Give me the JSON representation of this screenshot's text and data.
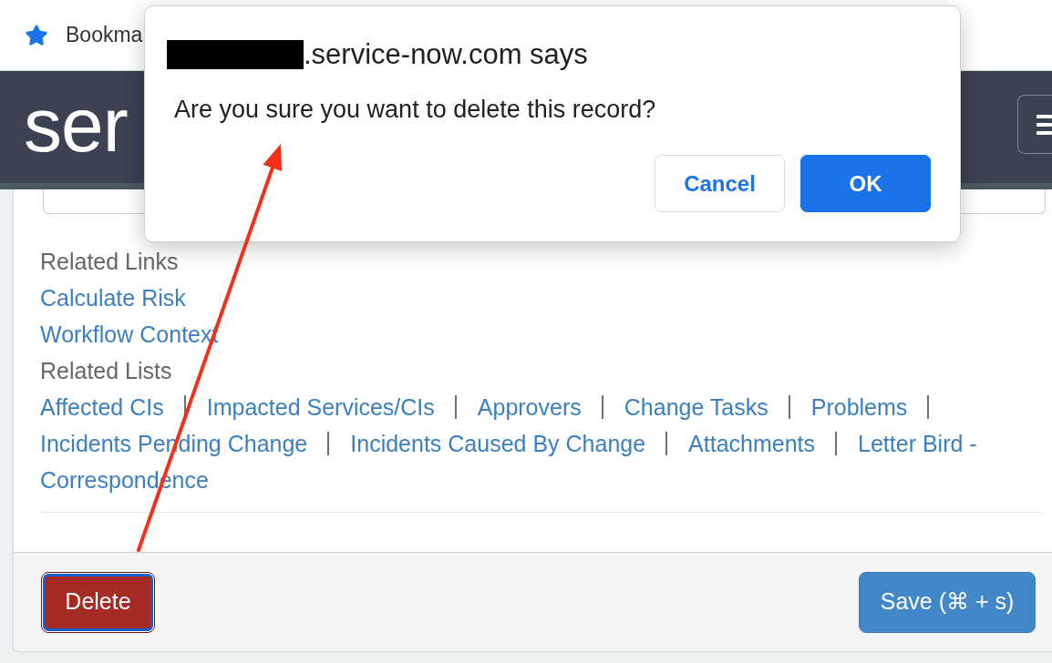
{
  "bookmarks_bar": {
    "items": [
      {
        "label": "Bookma"
      }
    ]
  },
  "header": {
    "logo": "ser"
  },
  "related_links": {
    "heading": "Related Links",
    "links": [
      "Calculate Risk",
      "Workflow Context"
    ]
  },
  "related_lists": {
    "heading": "Related Lists",
    "items": [
      {
        "lines": [
          "Affected CIs"
        ]
      },
      {
        "lines": [
          "Impacted Services/CIs"
        ]
      },
      {
        "lines": [
          "Approvers"
        ]
      },
      {
        "lines": [
          "Change Tasks"
        ]
      },
      {
        "lines": [
          "Problems"
        ]
      },
      {
        "lines": [
          "Incidents Pending Change"
        ]
      },
      {
        "lines": [
          "Incidents Caused By Change"
        ]
      },
      {
        "lines": [
          "Attachments"
        ]
      },
      {
        "lines": [
          "Letter Bird -",
          "Correspondence"
        ]
      }
    ]
  },
  "footer": {
    "buttons": [
      {
        "label": "Delete",
        "kind": "danger",
        "focused": true
      },
      {
        "label": "Save (⌘ + s)",
        "kind": "primary",
        "focused": false
      }
    ]
  },
  "dialog": {
    "title_redacted": true,
    "title": ".service-now.com says",
    "message": "Are you sure you want to delete this record?",
    "buttons": [
      {
        "label": "Cancel",
        "kind": "secondary"
      },
      {
        "label": "OK",
        "kind": "primary"
      }
    ]
  }
}
